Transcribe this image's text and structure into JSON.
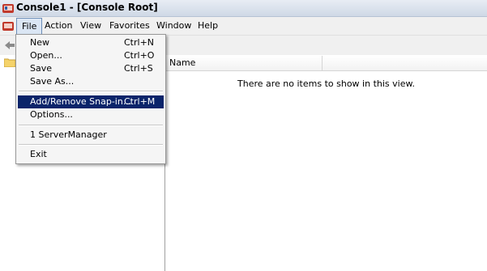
{
  "window": {
    "title": "Console1 - [Console Root]"
  },
  "menubar": {
    "items": [
      {
        "label": "File"
      },
      {
        "label": "Action"
      },
      {
        "label": "View"
      },
      {
        "label": "Favorites"
      },
      {
        "label": "Window"
      },
      {
        "label": "Help"
      }
    ]
  },
  "file_menu": {
    "items": [
      {
        "label": "New",
        "shortcut": "Ctrl+N"
      },
      {
        "label": "Open...",
        "shortcut": "Ctrl+O"
      },
      {
        "label": "Save",
        "shortcut": "Ctrl+S"
      },
      {
        "label": "Save As...",
        "shortcut": ""
      },
      {
        "label": "Add/Remove Snap-in...",
        "shortcut": "Ctrl+M",
        "highlighted": true
      },
      {
        "label": "Options...",
        "shortcut": ""
      },
      {
        "label": "1 ServerManager",
        "shortcut": ""
      },
      {
        "label": "Exit",
        "shortcut": ""
      }
    ]
  },
  "list_view": {
    "columns": [
      "Name"
    ],
    "empty_message": "There are no items to show in this view."
  },
  "icons": {
    "app": "mmc-console-icon",
    "mdi": "console-child-icon",
    "back": "back-arrow-icon",
    "tree_root": "folder-icon"
  },
  "colors": {
    "menu_highlight": "#0a246a",
    "active_menu": "#dbe6f4"
  }
}
